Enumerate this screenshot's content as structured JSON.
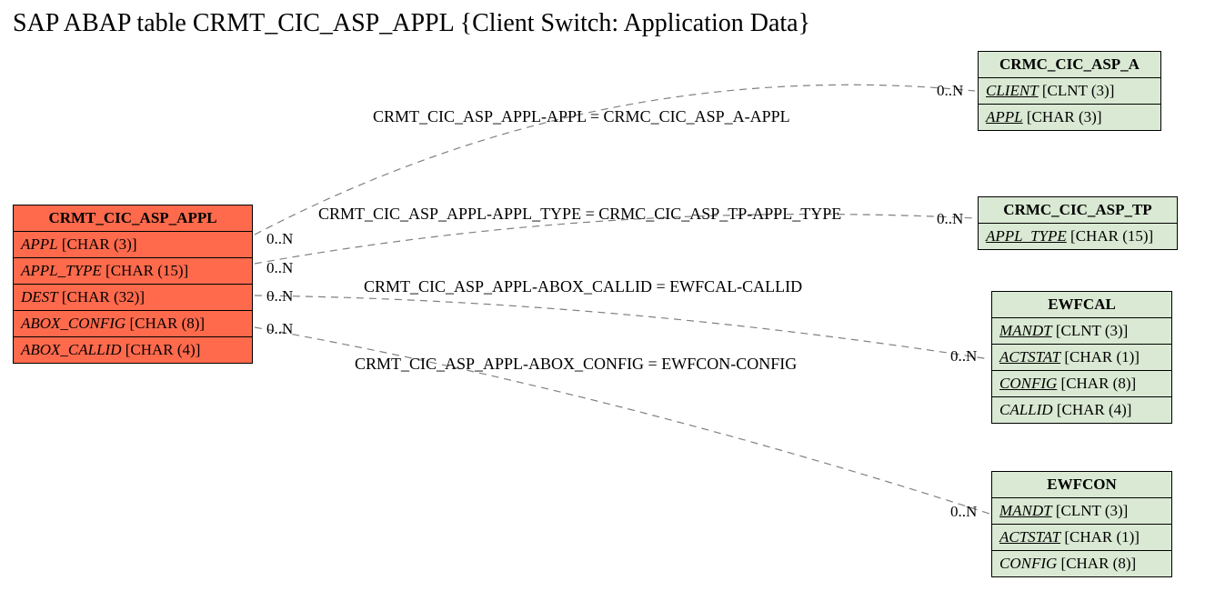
{
  "title": "SAP ABAP table CRMT_CIC_ASP_APPL {Client Switch: Application Data}",
  "main_entity": {
    "name": "CRMT_CIC_ASP_APPL",
    "fields": [
      {
        "name": "APPL",
        "type": "[CHAR (3)]",
        "key": false
      },
      {
        "name": "APPL_TYPE",
        "type": "[CHAR (15)]",
        "key": false
      },
      {
        "name": "DEST",
        "type": "[CHAR (32)]",
        "key": false
      },
      {
        "name": "ABOX_CONFIG",
        "type": "[CHAR (8)]",
        "key": false
      },
      {
        "name": "ABOX_CALLID",
        "type": "[CHAR (4)]",
        "key": false
      }
    ]
  },
  "related": [
    {
      "name": "CRMC_CIC_ASP_A",
      "fields": [
        {
          "name": "CLIENT",
          "type": "[CLNT (3)]",
          "key": true
        },
        {
          "name": "APPL",
          "type": "[CHAR (3)]",
          "key": true
        }
      ]
    },
    {
      "name": "CRMC_CIC_ASP_TP",
      "fields": [
        {
          "name": "APPL_TYPE",
          "type": "[CHAR (15)]",
          "key": true
        }
      ]
    },
    {
      "name": "EWFCAL",
      "fields": [
        {
          "name": "MANDT",
          "type": "[CLNT (3)]",
          "key": true
        },
        {
          "name": "ACTSTAT",
          "type": "[CHAR (1)]",
          "key": true
        },
        {
          "name": "CONFIG",
          "type": "[CHAR (8)]",
          "key": true
        },
        {
          "name": "CALLID",
          "type": "[CHAR (4)]",
          "key": false
        }
      ]
    },
    {
      "name": "EWFCON",
      "fields": [
        {
          "name": "MANDT",
          "type": "[CLNT (3)]",
          "key": true
        },
        {
          "name": "ACTSTAT",
          "type": "[CHAR (1)]",
          "key": true
        },
        {
          "name": "CONFIG",
          "type": "[CHAR (8)]",
          "key": false
        }
      ]
    }
  ],
  "relations": [
    {
      "label": "CRMT_CIC_ASP_APPL-APPL = CRMC_CIC_ASP_A-APPL",
      "left": "0..N",
      "right": "0..N"
    },
    {
      "label": "CRMT_CIC_ASP_APPL-APPL_TYPE = CRMC_CIC_ASP_TP-APPL_TYPE",
      "left": "0..N",
      "right": "0..N"
    },
    {
      "label": "CRMT_CIC_ASP_APPL-ABOX_CALLID = EWFCAL-CALLID",
      "left": "0..N",
      "right": "0..N"
    },
    {
      "label": "CRMT_CIC_ASP_APPL-ABOX_CONFIG = EWFCON-CONFIG",
      "left": "0..N",
      "right": "0..N"
    }
  ]
}
